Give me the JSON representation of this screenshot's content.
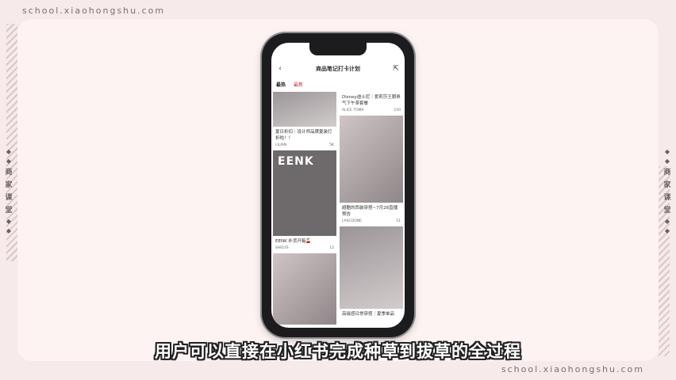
{
  "watermark_top": "school.xiaohongshu.com",
  "watermark_bottom": "school.xiaohongshu.com",
  "side_left": {
    "chars": [
      "商",
      "家",
      "课",
      "堂"
    ]
  },
  "side_right": {
    "chars": [
      "商",
      "家",
      "课",
      "堂"
    ]
  },
  "app": {
    "title": "商品笔记打卡计划",
    "back_icon": "chevron-left-icon",
    "share_icon": "share-icon",
    "tabs": [
      {
        "label": "最热",
        "active": true
      },
      {
        "label": "最新",
        "active": false
      }
    ]
  },
  "feed_left": [
    {
      "caption": "",
      "author": "",
      "likes": ""
    },
    {
      "caption": "夏日折扣｜设计师品牌夏装打折啦！！",
      "author": "LILIAN",
      "likes": "5K"
    },
    {
      "caption": "EENK 补货开箱🍒",
      "author": "SHELYS",
      "likes": "12",
      "overlay": "EENK"
    },
    {
      "caption": "",
      "author": "",
      "likes": ""
    }
  ],
  "feed_right": [
    {
      "caption": "Disney迪士尼｜爱莉莎王朝贵气下午茶套餐",
      "author": "ALICE TOMA",
      "likes": "150"
    },
    {
      "caption": "超酷的西装穿搭~7月28直播预告",
      "author": "LASCOONE",
      "likes": "51"
    },
    {
      "caption": "",
      "author": "",
      "likes": ""
    },
    {
      "caption": "高级感日常穿搭｜夏季单品",
      "author": "",
      "likes": ""
    }
  ],
  "subtitle": "用户可以直接在小红书完成种草到拔草的全过程"
}
